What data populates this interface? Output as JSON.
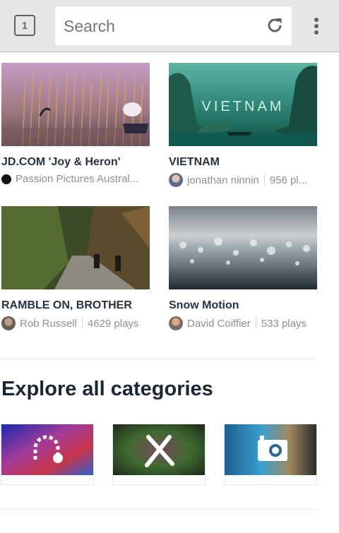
{
  "browser": {
    "tab_count": "1",
    "search_placeholder": "Search",
    "reload_icon": "reload-icon",
    "menu_icon": "overflow-menu-icon"
  },
  "videos": [
    {
      "title": "JD.COM 'Joy & Heron'",
      "author": "Passion Pictures Austral...",
      "plays": ""
    },
    {
      "title": "VIETNAM",
      "thumb_text": "VIETNAM",
      "author": "jonathan ninnin",
      "plays": "956 pl..."
    },
    {
      "title": "RAMBLE ON, BROTHER",
      "author": "Rob Russell",
      "plays": "4629 plays"
    },
    {
      "title": "Snow Motion",
      "author": "David Coiffier",
      "plays": "533 plays"
    }
  ],
  "explore": {
    "heading": "Explore all categories",
    "categories": [
      {
        "icon": "animation-icon"
      },
      {
        "icon": "arts-design-icon"
      },
      {
        "icon": "camera-icon"
      }
    ]
  },
  "colors": {
    "title_text": "#253341",
    "meta_text": "#8a9096",
    "toolbar_bg": "#e6e6e6"
  }
}
